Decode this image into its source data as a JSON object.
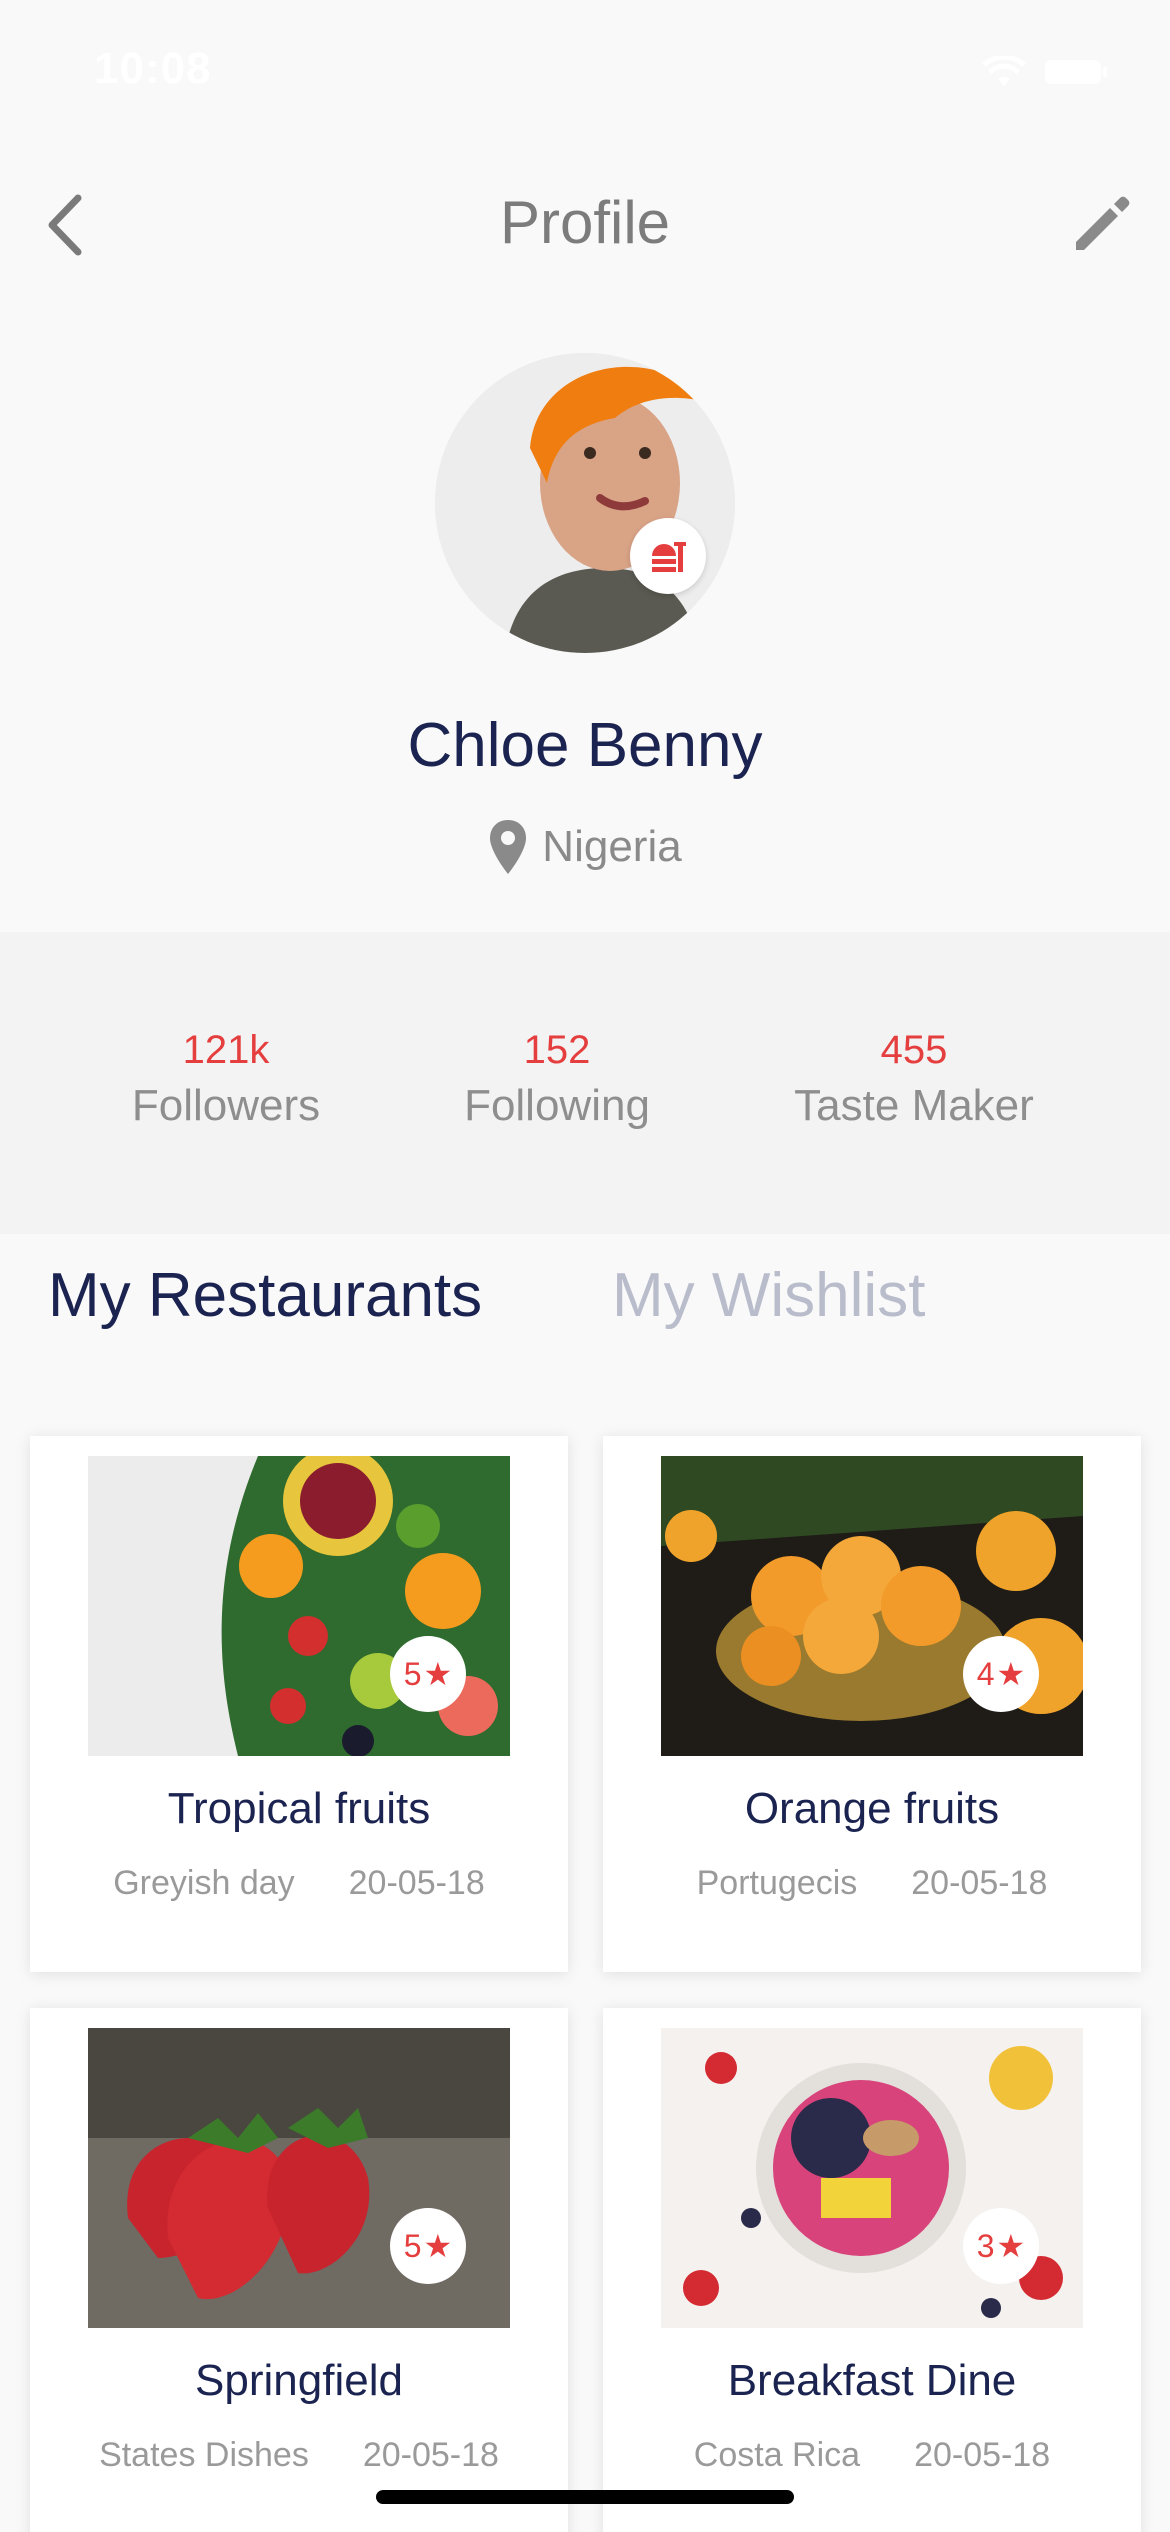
{
  "status_bar": {
    "time": "10:08"
  },
  "nav": {
    "title": "Profile",
    "back_icon": "chevron-left-icon",
    "edit_icon": "pencil-icon"
  },
  "profile": {
    "name": "Chloe Benny",
    "location": "Nigeria",
    "badge_icon": "food-icon"
  },
  "stats": [
    {
      "value": "121k",
      "label": "Followers"
    },
    {
      "value": "152",
      "label": "Following"
    },
    {
      "value": "455",
      "label": "Taste Maker"
    }
  ],
  "tabs": [
    {
      "label": "My Restaurants",
      "active": true
    },
    {
      "label": "My Wishlist",
      "active": false
    }
  ],
  "restaurants": [
    {
      "title": "Tropical fruits",
      "subtitle": "Greyish day",
      "date": "20-05-18",
      "rating": "5"
    },
    {
      "title": "Orange fruits",
      "subtitle": "Portugecis",
      "date": "20-05-18",
      "rating": "4"
    },
    {
      "title": "Springfield",
      "subtitle": "States Dishes",
      "date": "20-05-18",
      "rating": "5"
    },
    {
      "title": "Breakfast Dine",
      "subtitle": "Costa Rica",
      "date": "20-05-18",
      "rating": "3"
    }
  ],
  "colors": {
    "accent": "#e53e3e",
    "primary_text": "#1b2350",
    "muted_text": "#8e8e8e"
  }
}
